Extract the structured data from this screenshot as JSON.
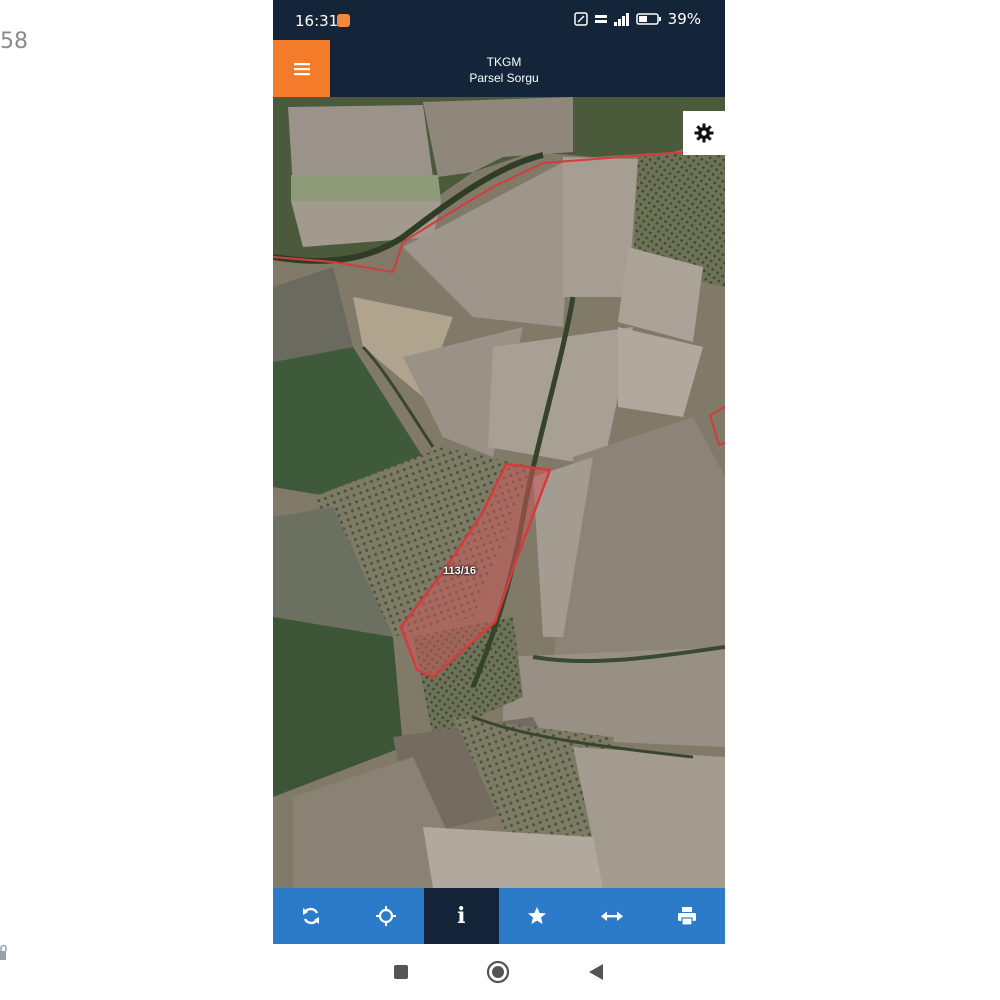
{
  "edge_text": "58",
  "status": {
    "time": "16:31",
    "battery": "39%",
    "icons": [
      "notification-icon",
      "nfc-icon",
      "volte-icon",
      "signal-icon",
      "battery-icon"
    ]
  },
  "header": {
    "title": "TKGM",
    "subtitle": "Parsel Sorgu",
    "menu_icon": "hamburger-menu-icon",
    "accent": "#f47b2a",
    "background": "#14253a"
  },
  "map": {
    "parcel_label": "113/16",
    "settings_icon": "gear-icon",
    "parcel_color": "#d63b3b"
  },
  "toolbar": {
    "background": "#2b7bc9",
    "active_background": "#14253a",
    "items": [
      {
        "icon": "refresh-icon"
      },
      {
        "icon": "locate-icon"
      },
      {
        "icon": "info-icon",
        "label": "i",
        "active": true
      },
      {
        "icon": "star-icon"
      },
      {
        "icon": "measure-icon"
      },
      {
        "icon": "print-icon"
      }
    ]
  },
  "navbar": {
    "items": [
      "recents-icon",
      "home-icon",
      "back-icon"
    ]
  }
}
